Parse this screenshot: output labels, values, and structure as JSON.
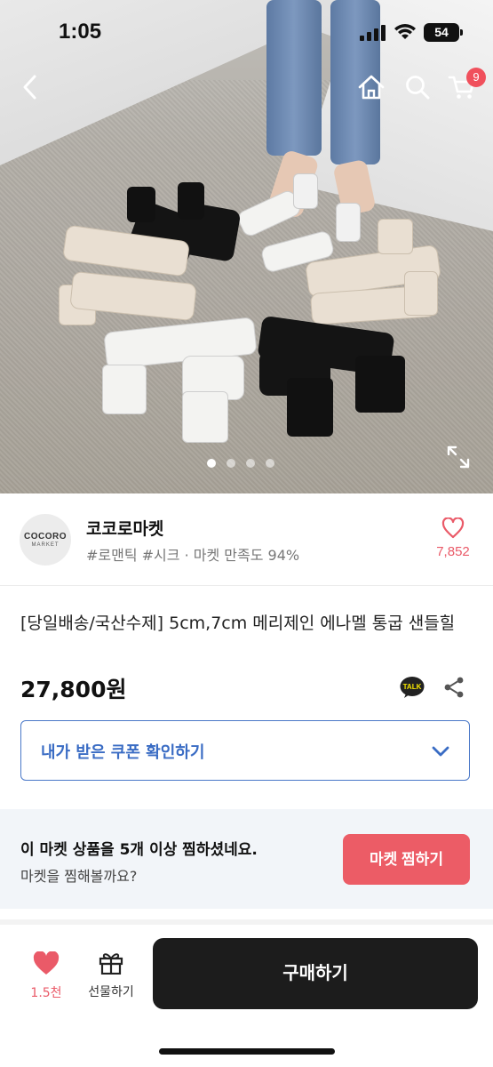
{
  "status_bar": {
    "time": "1:05",
    "battery": "54"
  },
  "nav": {
    "back_icon": "chevron-left-icon",
    "home_icon": "home-icon",
    "search_icon": "search-icon",
    "cart_icon": "cart-icon",
    "cart_count": "9"
  },
  "hero": {
    "image_alt": "black, white and cream sandals arranged in a circle",
    "pages": 4,
    "active_page": 1,
    "expand_icon": "expand-icon"
  },
  "shop": {
    "logo_line1": "COCORO",
    "logo_line2": "MARKET",
    "name": "코코로마켓",
    "tags": "#로맨틱 #시크 · 마켓 만족도 94%",
    "favorites": "7,852"
  },
  "product": {
    "title": "[당일배송/국산수제] 5cm,7cm 메리제인 에나멜 통굽 샌들힐",
    "price": "27,800원",
    "talk_label": "TALK"
  },
  "coupon": {
    "label": "내가 받은 쿠폰 확인하기"
  },
  "banner": {
    "message": "이 마켓 상품을 5개 이상 찜하셨네요.",
    "sub": "마켓을 찜해볼까요?",
    "button": "마켓 찜하기"
  },
  "bottom_bar": {
    "likes": "1.5천",
    "gift": "선물하기",
    "buy": "구매하기"
  },
  "colors": {
    "accent_red": "#ec5c66",
    "coupon_blue": "#3a6cc4",
    "buy_black": "#1c1c1c"
  }
}
